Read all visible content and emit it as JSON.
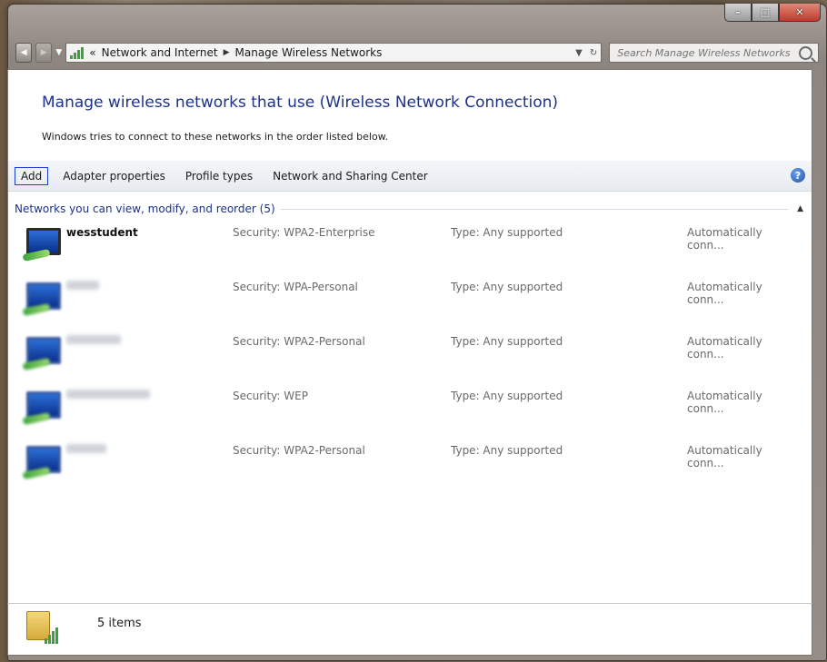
{
  "window": {
    "minimize": "–",
    "maximize": "□",
    "close": "✕"
  },
  "navigation": {
    "back": "◀",
    "forward": "▶",
    "recent": "▼",
    "overflow": "«",
    "breadcrumbs": [
      "Network and Internet",
      "Manage Wireless Networks"
    ],
    "separator": "▶",
    "dropdown": "▼",
    "refresh": "↻"
  },
  "search": {
    "placeholder": "Search Manage Wireless Networks"
  },
  "main": {
    "title": "Manage wireless networks that use (Wireless Network Connection)",
    "subtitle": "Windows tries to connect to these networks in the order listed below."
  },
  "toolbar": {
    "buttons": [
      "Add",
      "Adapter properties",
      "Profile types",
      "Network and Sharing Center"
    ],
    "help": "?"
  },
  "group": {
    "header": "Networks you can view, modify, and reorder (5)",
    "collapse": "▲"
  },
  "networks": [
    {
      "name": "wesstudent",
      "security": "Security: WPA2-Enterprise",
      "type": "Type: Any supported",
      "auto": "Automatically conn..."
    },
    {
      "name": "",
      "security": "Security: WPA-Personal",
      "type": "Type: Any supported",
      "auto": "Automatically conn..."
    },
    {
      "name": "",
      "security": "Security: WPA2-Personal",
      "type": "Type: Any supported",
      "auto": "Automatically conn..."
    },
    {
      "name": "",
      "security": "Security: WEP",
      "type": "Type: Any supported",
      "auto": "Automatically conn..."
    },
    {
      "name": "",
      "security": "Security: WPA2-Personal",
      "type": "Type: Any supported",
      "auto": "Automatically conn..."
    }
  ],
  "status": {
    "items": "5 items"
  },
  "icons": {
    "network": "network-monitor-icon",
    "folder": "wireless-folder-icon",
    "search": "search-icon",
    "help": "help-icon"
  },
  "colors": {
    "title": "#1e3287",
    "accent": "#1a3fd0",
    "signal": "#3ba33b"
  }
}
